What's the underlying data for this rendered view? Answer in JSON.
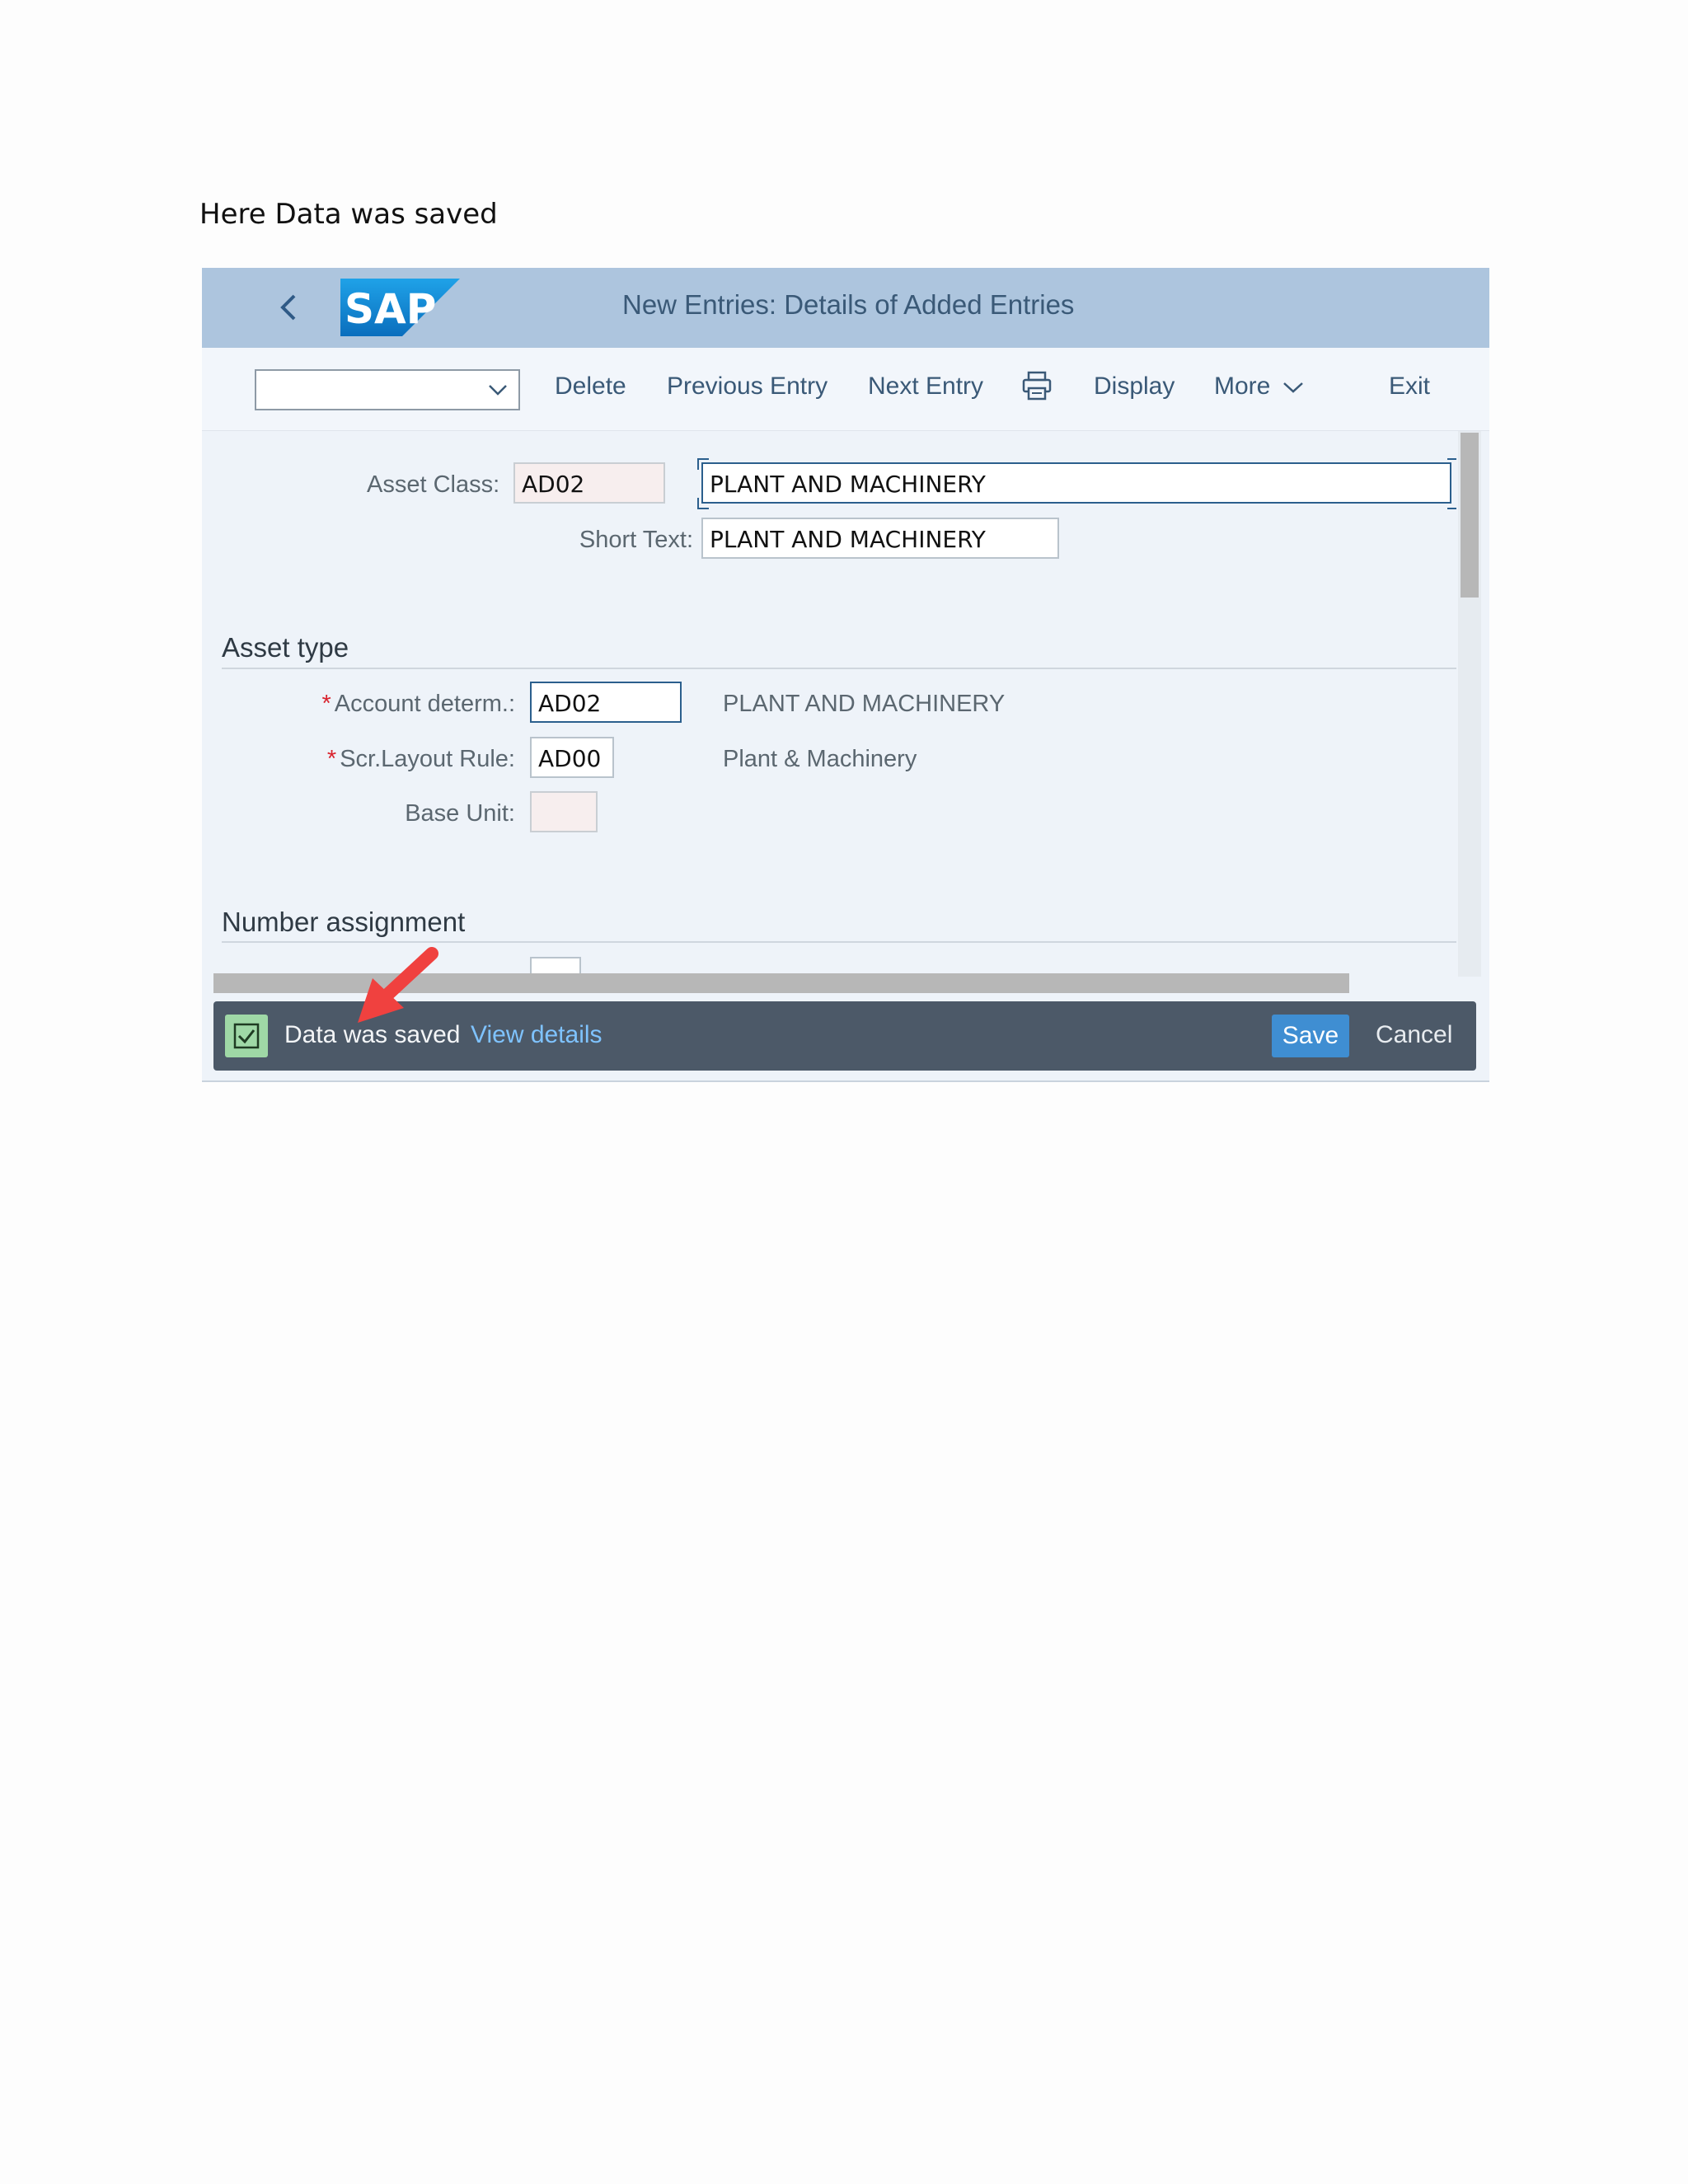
{
  "document": {
    "caption": "Here Data was saved"
  },
  "shell": {
    "title": "New Entries: Details of Added Entries",
    "logo_text": "SAP"
  },
  "toolbar": {
    "select_value": "",
    "delete": "Delete",
    "previous_entry": "Previous Entry",
    "next_entry": "Next Entry",
    "print_icon": "printer-icon",
    "display": "Display",
    "more": "More",
    "exit": "Exit"
  },
  "form": {
    "asset_class": {
      "label": "Asset Class:",
      "value": "AD02",
      "description": "PLANT AND MACHINERY"
    },
    "short_text": {
      "label": "Short Text:",
      "value": "PLANT AND MACHINERY"
    },
    "asset_type": {
      "title": "Asset type",
      "account_determ": {
        "label": "Account determ.:",
        "value": "AD02",
        "description": "PLANT AND MACHINERY",
        "required": true
      },
      "scr_layout_rule": {
        "label": "Scr.Layout Rule:",
        "value": "AD00",
        "description": "Plant & Machinery",
        "required": true
      },
      "base_unit": {
        "label": "Base Unit:",
        "value": ""
      }
    },
    "number_assignment": {
      "title": "Number assignment"
    }
  },
  "message": {
    "text": "Data was saved",
    "link": "View details",
    "save": "Save",
    "cancel": "Cancel",
    "status_color": "#9fd8a6"
  },
  "colors": {
    "shell": "#adc5de",
    "accent": "#3f8ed2",
    "annotation": "#f0413f"
  }
}
